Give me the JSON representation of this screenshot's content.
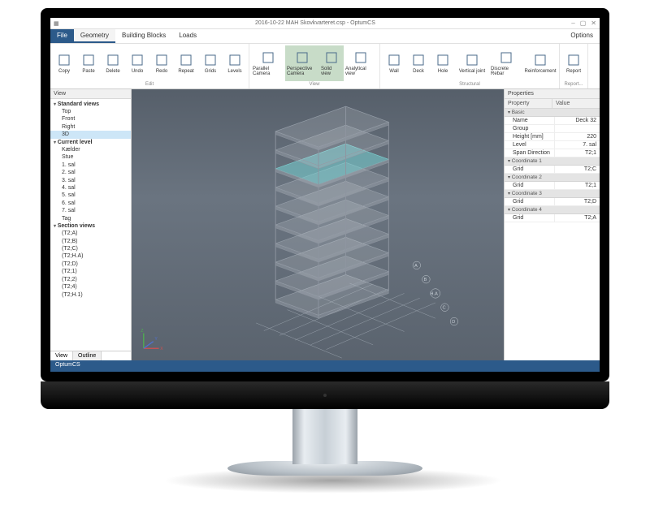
{
  "window": {
    "title": "2016-10-22 MAH Skovkvarteret.csp - OptumCS",
    "options_label": "Options"
  },
  "winctrls": {
    "min": "–",
    "max": "▢",
    "close": "✕"
  },
  "menu_tabs": [
    "File",
    "Geometry",
    "Building Blocks",
    "Loads"
  ],
  "ribbon": {
    "groups": [
      {
        "label": "Edit",
        "buttons": [
          {
            "name": "copy-button",
            "label": "Copy",
            "icon": "copy-icon"
          },
          {
            "name": "paste-button",
            "label": "Paste",
            "icon": "paste-icon"
          },
          {
            "name": "delete-button",
            "label": "Delete",
            "icon": "delete-icon"
          },
          {
            "name": "undo-button",
            "label": "Undo",
            "icon": "undo-icon"
          },
          {
            "name": "redo-button",
            "label": "Redo",
            "icon": "redo-icon"
          },
          {
            "name": "repeat-button",
            "label": "Repeat",
            "icon": "repeat-icon"
          },
          {
            "name": "grids-button",
            "label": "Grids",
            "icon": "grids-icon"
          },
          {
            "name": "levels-button",
            "label": "Levels",
            "icon": "levels-icon"
          }
        ]
      },
      {
        "label": "View",
        "buttons": [
          {
            "name": "parallel-camera-button",
            "label": "Parallel Camera",
            "icon": "camera-icon",
            "wide": true
          },
          {
            "name": "perspective-camera-button",
            "label": "Perspective Camera",
            "icon": "camera-icon",
            "wide": true,
            "active": true
          },
          {
            "name": "solid-view-button",
            "label": "Solid view",
            "icon": "solid-icon",
            "active": true
          },
          {
            "name": "analytical-view-button",
            "label": "Analytical view",
            "icon": "analytical-icon",
            "wide": true
          }
        ]
      },
      {
        "label": "Structural",
        "buttons": [
          {
            "name": "wall-button",
            "label": "Wall",
            "icon": "wall-icon"
          },
          {
            "name": "deck-button",
            "label": "Deck",
            "icon": "deck-icon"
          },
          {
            "name": "hole-button",
            "label": "Hole",
            "icon": "hole-icon"
          },
          {
            "name": "vertical-joint-button",
            "label": "Vertical joint",
            "icon": "vjoint-icon",
            "wide": true
          },
          {
            "name": "discrete-rebar-button",
            "label": "Discrete Rebar",
            "icon": "rebar-icon",
            "wide": true
          },
          {
            "name": "reinforcement-button",
            "label": "Reinforcement",
            "icon": "reinf-icon",
            "wide": true
          }
        ]
      },
      {
        "label": "Report...",
        "buttons": [
          {
            "name": "report-button",
            "label": "Report",
            "icon": "report-icon"
          }
        ]
      }
    ]
  },
  "left": {
    "header": "View",
    "groups": [
      {
        "label": "Standard views",
        "items": [
          "Top",
          "Front",
          "Right",
          "3D"
        ],
        "selected": "3D"
      },
      {
        "label": "Current level",
        "items": [
          "Kælder",
          "Stue",
          "1. sal",
          "2. sal",
          "3. sal",
          "4. sal",
          "5. sal",
          "6. sal",
          "7. sal",
          "Tag"
        ]
      },
      {
        "label": "Section views",
        "items": [
          "(T2;A)",
          "(T2;B)",
          "(T2;C)",
          "(T2;H.A)",
          "(T2;D)",
          "(T2;1)",
          "(T2;2)",
          "(T2;4)",
          "(T2;H.1)"
        ]
      }
    ],
    "bottom_tabs": [
      "View",
      "Outline"
    ]
  },
  "viewport": {
    "grid_labels": [
      "A",
      "B",
      "H.A",
      "C",
      "D"
    ],
    "axis": {
      "x": "X",
      "y": "Y",
      "z": "Z"
    }
  },
  "right": {
    "header": "Properties",
    "col_property": "Property",
    "col_value": "Value",
    "sections": [
      {
        "label": "Basic",
        "rows": [
          {
            "k": "Name",
            "v": "Deck 32"
          },
          {
            "k": "Group",
            "v": ""
          },
          {
            "k": "Height [mm]",
            "v": "220"
          },
          {
            "k": "Level",
            "v": "7. sal"
          },
          {
            "k": "Span Direction",
            "v": "T2;1"
          }
        ]
      },
      {
        "label": "Coordinate 1",
        "rows": [
          {
            "k": "Grid",
            "v": "T2;C"
          }
        ]
      },
      {
        "label": "Coordinate 2",
        "rows": [
          {
            "k": "Grid",
            "v": "T2;1"
          }
        ]
      },
      {
        "label": "Coordinate 3",
        "rows": [
          {
            "k": "Grid",
            "v": "T2;D"
          }
        ]
      },
      {
        "label": "Coordinate 4",
        "rows": [
          {
            "k": "Grid",
            "v": "T2;A"
          }
        ]
      }
    ]
  },
  "status": {
    "text": "OptumCS"
  }
}
